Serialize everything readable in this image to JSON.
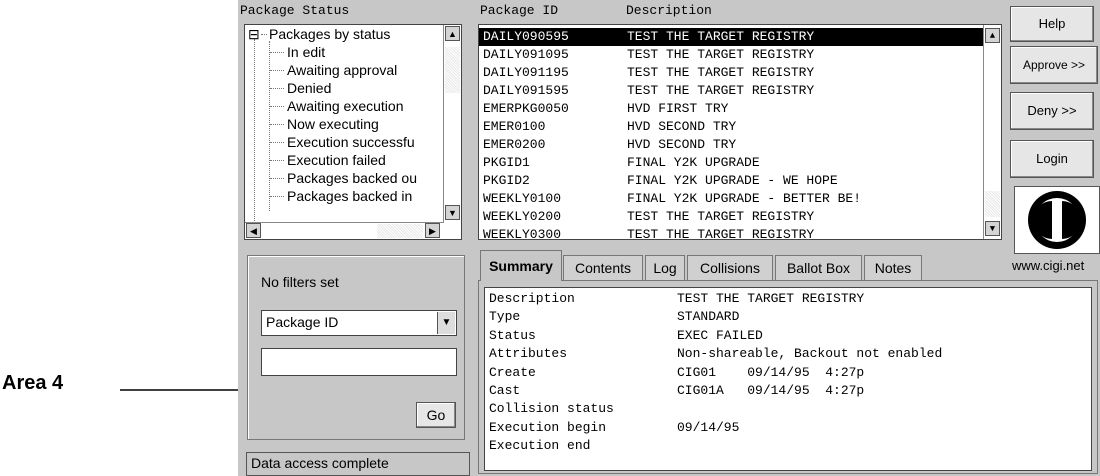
{
  "headers": {
    "package_status": "Package Status",
    "package_id": "Package ID",
    "description": "Description"
  },
  "tree": {
    "root": "Packages by status",
    "collapse_glyph": "⊟",
    "items": [
      "In edit",
      "Awaiting approval",
      "Denied",
      "Awaiting execution",
      "Now executing",
      "Execution successfu",
      "Execution failed",
      "Packages backed ou",
      "Packages backed in"
    ]
  },
  "packages": [
    {
      "id": "DAILY090595",
      "desc": "TEST THE TARGET REGISTRY"
    },
    {
      "id": "DAILY091095",
      "desc": "TEST THE TARGET REGISTRY"
    },
    {
      "id": "DAILY091195",
      "desc": "TEST THE TARGET REGISTRY"
    },
    {
      "id": "DAILY091595",
      "desc": "TEST THE TARGET REGISTRY"
    },
    {
      "id": "EMERPKG0050",
      "desc": "HVD FIRST TRY"
    },
    {
      "id": "EMER0100",
      "desc": "HVD SECOND TRY"
    },
    {
      "id": "EMER0200",
      "desc": "HVD SECOND TRY"
    },
    {
      "id": "PKGID1",
      "desc": "FINAL Y2K UPGRADE"
    },
    {
      "id": "PKGID2",
      "desc": "FINAL Y2K UPGRADE - WE HOPE"
    },
    {
      "id": "WEEKLY0100",
      "desc": "FINAL Y2K UPGRADE - BETTER BE!"
    },
    {
      "id": "WEEKLY0200",
      "desc": "TEST THE TARGET REGISTRY"
    },
    {
      "id": "WEEKLY0300",
      "desc": "TEST THE TARGET REGISTRY"
    }
  ],
  "selected_package_index": 0,
  "buttons": {
    "help": "Help",
    "approve": "Approve >>",
    "deny": "Deny >>",
    "login": "Login"
  },
  "brand": {
    "url": "www.cigi.net"
  },
  "filter": {
    "status": "No filters set",
    "field_select": "Package ID",
    "value_input": "",
    "go": "Go"
  },
  "status_bar": "Data access complete",
  "tabs": [
    "Summary",
    "Contents",
    "Log",
    "Collisions",
    "Ballot Box",
    "Notes"
  ],
  "active_tab": "Summary",
  "summary": [
    {
      "label": "Description",
      "value": "TEST THE TARGET REGISTRY"
    },
    {
      "label": "Type",
      "value": "STANDARD"
    },
    {
      "label": "Status",
      "value": "EXEC FAILED"
    },
    {
      "label": "Attributes",
      "value": "Non-shareable, Backout not enabled"
    },
    {
      "label": "Create",
      "value": "CIG01    09/14/95  4:27p"
    },
    {
      "label": "Cast",
      "value": "CIG01A   09/14/95  4:27p"
    },
    {
      "label": "Collision status",
      "value": ""
    },
    {
      "label": "Execution begin",
      "value": "09/14/95"
    },
    {
      "label": "Execution end",
      "value": ""
    }
  ],
  "annotation": {
    "label": "Area 4"
  },
  "glyphs": {
    "up": "▲",
    "down": "▼",
    "left": "◀",
    "right": "▶"
  }
}
